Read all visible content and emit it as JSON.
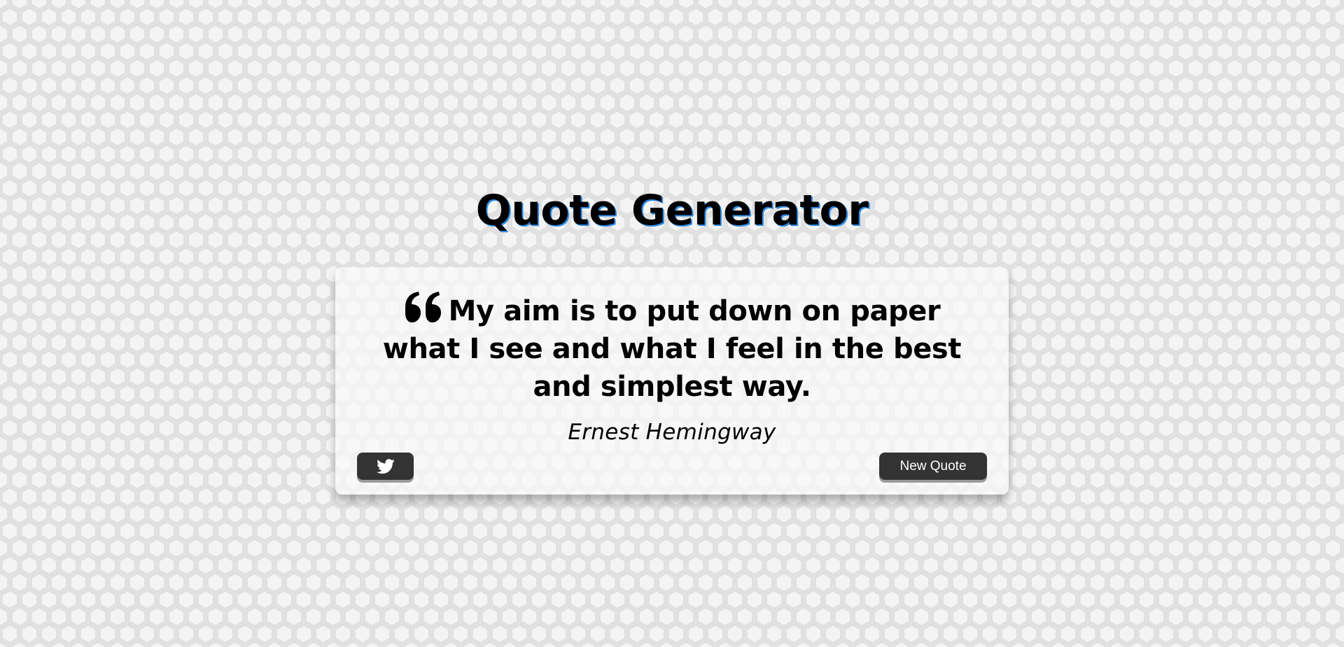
{
  "header": {
    "title": "Quote Generator"
  },
  "quote": {
    "text": "My aim is to put down on paper what I see and what I feel in the best and simplest way.",
    "author": "Ernest Hemingway",
    "icon": "quote-left-icon"
  },
  "actions": {
    "tweet_icon": "twitter-icon",
    "new_quote_label": "New Quote"
  },
  "colors": {
    "title_shadow": "#2b8ce6",
    "button_bg": "#333333",
    "button_text": "#ffffff"
  }
}
